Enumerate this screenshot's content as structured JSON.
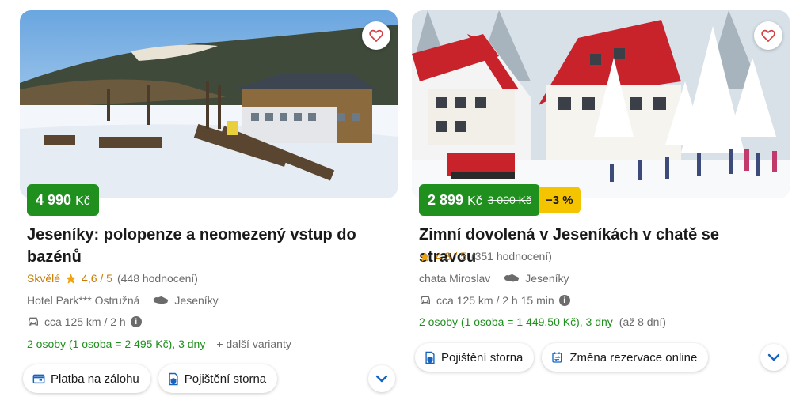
{
  "cards": [
    {
      "price_amount": "4 990",
      "price_currency": "Kč",
      "title": "Jeseníky: polopenze a neomezený vstup do bazénů",
      "rating_word": "Skvělé",
      "rating_value": "4,6 / 5",
      "rating_count": "(448 hodnocení)",
      "hotel": "Hotel Park*** Ostružná",
      "region": "Jeseníky",
      "distance": "cca 125 km / 2 h",
      "persons": "2 osoby (1 osoba = 2 495 Kč), 3 dny",
      "variants": "+  další varianty",
      "tags": [
        "Platba na zálohu",
        "Pojištění storna"
      ]
    },
    {
      "price_amount": "2 899",
      "price_currency": "Kč",
      "price_old": "3 000 Kč",
      "discount": "−3 %",
      "title": "Zimní dovolená v Jeseníkách v chatě se stravou",
      "rating_value": "4,3 / 5",
      "rating_count": "(351 hodnocení)",
      "hotel": "chata Miroslav",
      "region": "Jeseníky",
      "distance": "cca 125 km / 2 h 15 min",
      "persons": "2 osoby (1 osoba = 1 449,50 Kč), 3 dny",
      "duration_range": "(až 8 dní)",
      "tags": [
        "Pojištění storna",
        "Změna rezervace online"
      ]
    }
  ],
  "colors": {
    "price_bg": "#1f8f1d",
    "discount_bg": "#f5c400",
    "rating": "#c77a00",
    "accent_blue": "#1565c0"
  }
}
